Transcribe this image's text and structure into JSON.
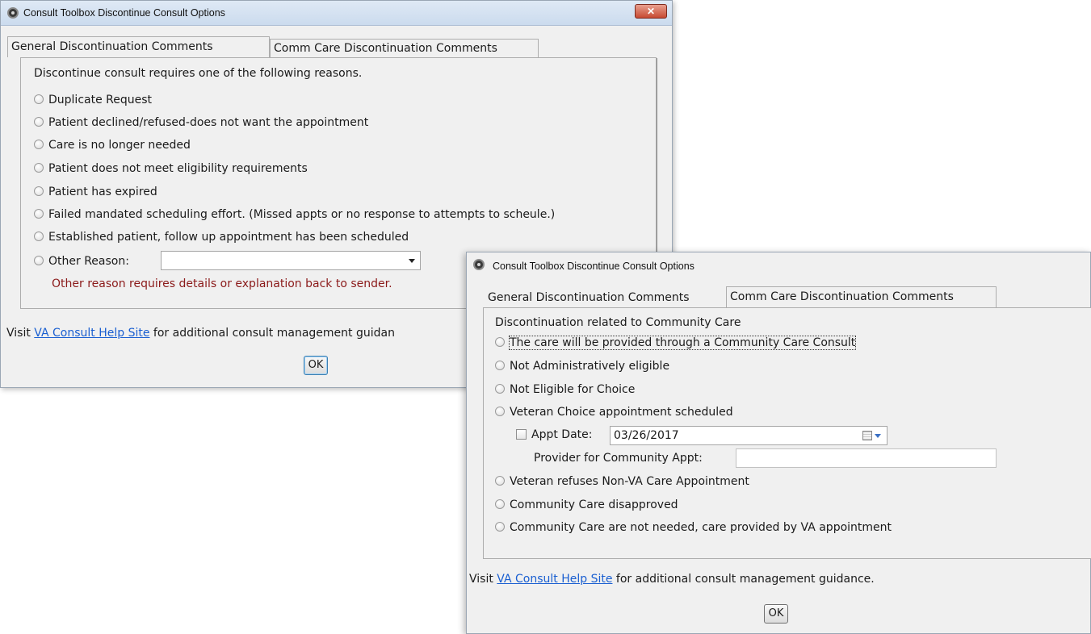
{
  "dialog1": {
    "title": "Consult Toolbox Discontinue Consult Options",
    "close_label": "✕",
    "tabs": [
      {
        "label": "General Discontinuation Comments"
      },
      {
        "label": "Comm Care Discontinuation Comments"
      }
    ],
    "intro": "Discontinue consult requires one of the following reasons.",
    "reasons": [
      {
        "label": "Duplicate Request"
      },
      {
        "label": "Patient declined/refused-does not want the appointment"
      },
      {
        "label": "Care is no longer needed"
      },
      {
        "label": "Patient does not meet eligibility requirements"
      },
      {
        "label": "Patient has expired"
      },
      {
        "label": "Failed mandated scheduling effort. (Missed appts or no response to attempts to scheule.)"
      },
      {
        "label": "Established patient, follow up appointment has been scheduled"
      },
      {
        "label": "Other Reason:"
      }
    ],
    "other_reason_value": "",
    "other_reason_warning": "Other reason requires details or explanation back to sender.",
    "footer_prefix": "Visit ",
    "footer_link": "VA Consult Help Site",
    "footer_suffix": " for additional consult management guidan",
    "ok_label": "OK"
  },
  "dialog2": {
    "title": "Consult Toolbox Discontinue Consult Options",
    "tabs": [
      {
        "label": "General Discontinuation Comments"
      },
      {
        "label": "Comm Care Discontinuation Comments"
      }
    ],
    "intro": "Discontinuation related to Community Care",
    "reasons": [
      {
        "label": "The care will be provided through a Community Care Consult"
      },
      {
        "label": "Not Administratively eligible"
      },
      {
        "label": "Not Eligible for Choice"
      },
      {
        "label": "Veteran Choice appointment scheduled"
      },
      {
        "label": "Veteran refuses Non-VA Care Appointment"
      },
      {
        "label": "Community Care disapproved"
      },
      {
        "label": "Community Care are not needed, care provided by VA appointment"
      }
    ],
    "appt_date_label": "Appt Date:",
    "appt_date_value": "03/26/2017",
    "provider_label": "Provider for Community Appt:",
    "provider_value": "",
    "footer_prefix": "Visit ",
    "footer_link": "VA Consult Help Site",
    "footer_suffix": " for additional consult management guidance.",
    "ok_label": "OK"
  }
}
